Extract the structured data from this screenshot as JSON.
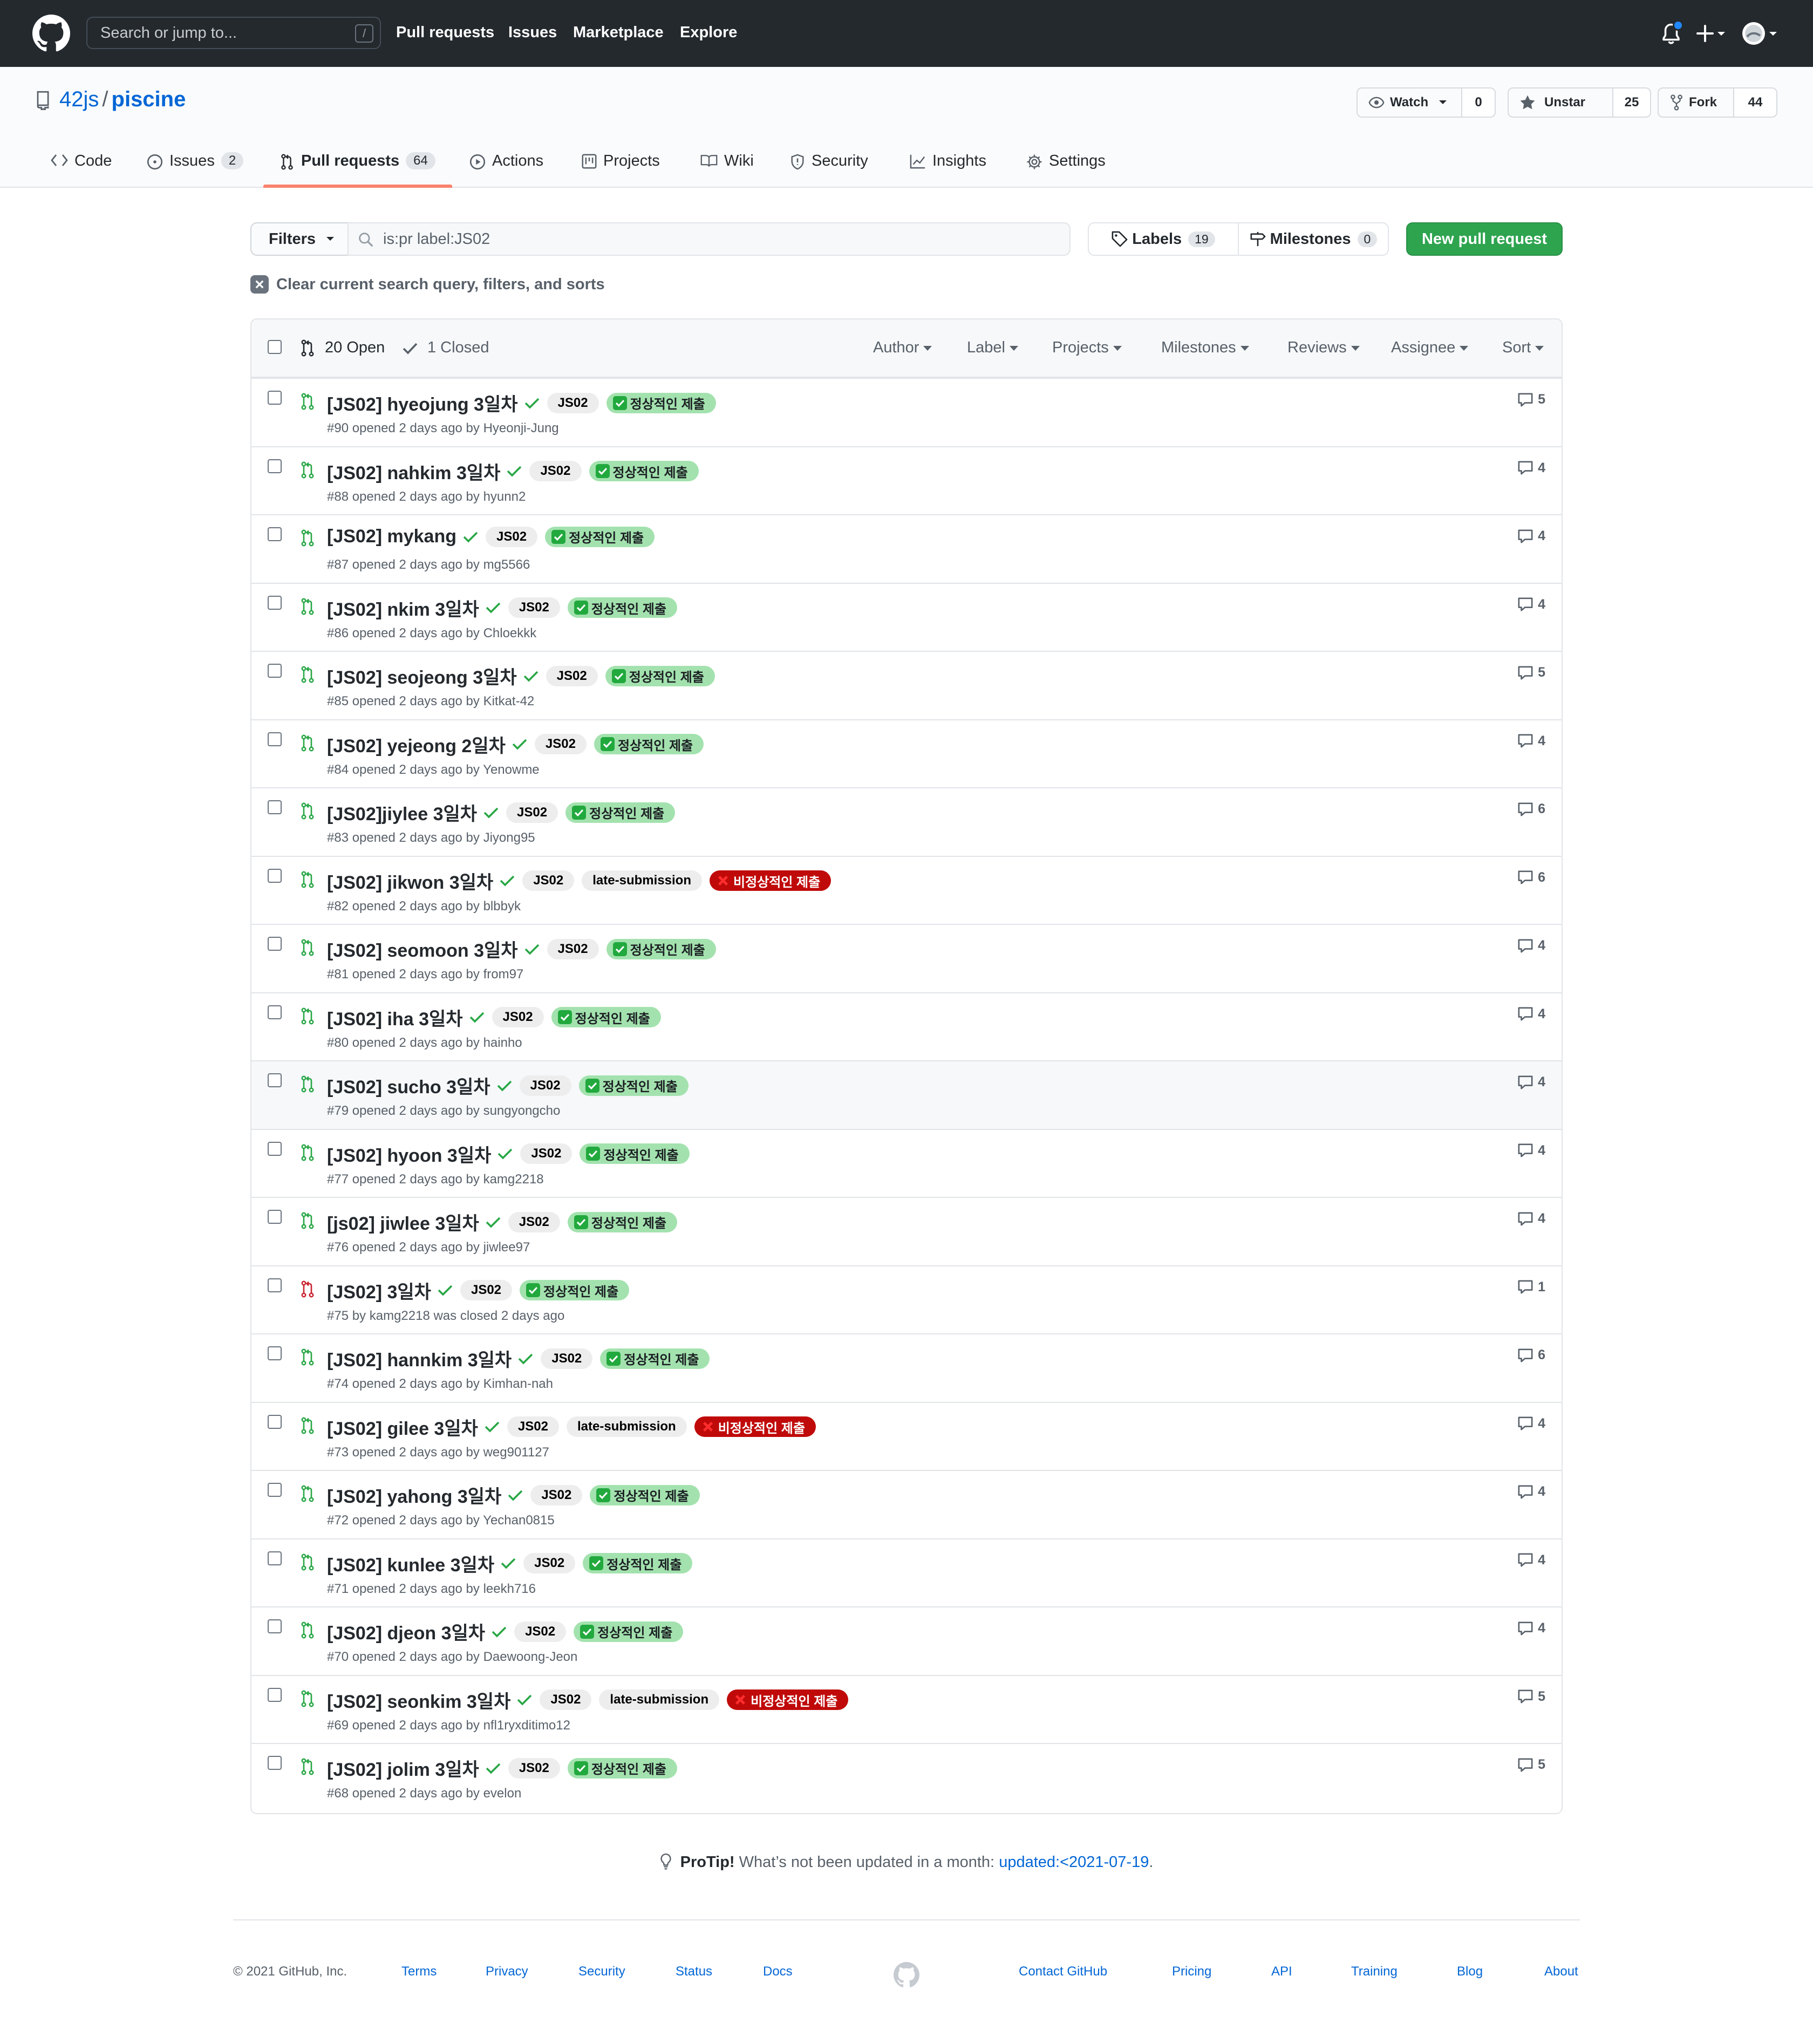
{
  "header": {
    "search_placeholder": "Search or jump to...",
    "search_shortcut": "/",
    "nav": [
      "Pull requests",
      "Issues",
      "Marketplace",
      "Explore"
    ]
  },
  "repo": {
    "owner": "42js",
    "separator": "/",
    "name": "piscine",
    "watch_label": "Watch",
    "watch_count": "0",
    "star_label": "Unstar",
    "star_count": "25",
    "fork_label": "Fork",
    "fork_count": "44"
  },
  "tabs": [
    {
      "label": "Code",
      "counter": ""
    },
    {
      "label": "Issues",
      "counter": "2"
    },
    {
      "label": "Pull requests",
      "counter": "64"
    },
    {
      "label": "Actions",
      "counter": ""
    },
    {
      "label": "Projects",
      "counter": ""
    },
    {
      "label": "Wiki",
      "counter": ""
    },
    {
      "label": "Security",
      "counter": ""
    },
    {
      "label": "Insights",
      "counter": ""
    },
    {
      "label": "Settings",
      "counter": ""
    }
  ],
  "filters": {
    "filters_label": "Filters",
    "query": "is:pr label:JS02",
    "labels_label": "Labels",
    "labels_count": "19",
    "milestones_label": "Milestones",
    "milestones_count": "0",
    "new_pr_label": "New pull request",
    "clear_label": "Clear current search query, filters, and sorts"
  },
  "list_header": {
    "open": "20 Open",
    "closed": "1 Closed",
    "sorters": [
      "Author",
      "Label",
      "Projects",
      "Milestones",
      "Reviews",
      "Assignee",
      "Sort"
    ]
  },
  "label_texts": {
    "js02": "JS02",
    "late": "late-submission",
    "ok": "정상적인 제출",
    "bad": "비정상적인 제출"
  },
  "prs": [
    {
      "title": "[JS02] hyeojung 3일차",
      "meta": "#90 opened 2 days ago by Hyeonji-Jung",
      "comments": "5",
      "late": false,
      "status": "ok",
      "closed": false
    },
    {
      "title": "[JS02] nahkim 3일차",
      "meta": "#88 opened 2 days ago by hyunn2",
      "comments": "4",
      "late": false,
      "status": "ok",
      "closed": false
    },
    {
      "title": "[JS02] mykang",
      "meta": "#87 opened 2 days ago by mg5566",
      "comments": "4",
      "late": false,
      "status": "ok",
      "closed": false
    },
    {
      "title": "[JS02] nkim 3일차",
      "meta": "#86 opened 2 days ago by Chloekkk",
      "comments": "4",
      "late": false,
      "status": "ok",
      "closed": false
    },
    {
      "title": "[JS02] seojeong 3일차",
      "meta": "#85 opened 2 days ago by Kitkat-42",
      "comments": "5",
      "late": false,
      "status": "ok",
      "closed": false
    },
    {
      "title": "[JS02] yejeong 2일차",
      "meta": "#84 opened 2 days ago by Yenowme",
      "comments": "4",
      "late": false,
      "status": "ok",
      "closed": false
    },
    {
      "title": "[JS02]jiylee 3일차",
      "meta": "#83 opened 2 days ago by Jiyong95",
      "comments": "6",
      "late": false,
      "status": "ok",
      "closed": false
    },
    {
      "title": "[JS02] jikwon 3일차",
      "meta": "#82 opened 2 days ago by blbbyk",
      "comments": "6",
      "late": true,
      "status": "bad",
      "closed": false
    },
    {
      "title": "[JS02] seomoon 3일차",
      "meta": "#81 opened 2 days ago by from97",
      "comments": "4",
      "late": false,
      "status": "ok",
      "closed": false
    },
    {
      "title": "[JS02] iha 3일차",
      "meta": "#80 opened 2 days ago by hainho",
      "comments": "4",
      "late": false,
      "status": "ok",
      "closed": false
    },
    {
      "title": "[JS02] sucho 3일차",
      "meta": "#79 opened 2 days ago by sungyongcho",
      "comments": "4",
      "late": false,
      "status": "ok",
      "closed": false
    },
    {
      "title": "[JS02] hyoon 3일차",
      "meta": "#77 opened 2 days ago by kamg2218",
      "comments": "4",
      "late": false,
      "status": "ok",
      "closed": false
    },
    {
      "title": "[js02] jiwlee 3일차",
      "meta": "#76 opened 2 days ago by jiwlee97",
      "comments": "4",
      "late": false,
      "status": "ok",
      "closed": false
    },
    {
      "title": "[JS02] 3일차",
      "meta": "#75 by kamg2218 was closed 2 days ago",
      "comments": "1",
      "late": false,
      "status": "ok",
      "closed": true
    },
    {
      "title": "[JS02] hannkim 3일차",
      "meta": "#74 opened 2 days ago by Kimhan-nah",
      "comments": "6",
      "late": false,
      "status": "ok",
      "closed": false
    },
    {
      "title": "[JS02] gilee 3일차",
      "meta": "#73 opened 2 days ago by weg901127",
      "comments": "4",
      "late": true,
      "status": "bad",
      "closed": false
    },
    {
      "title": "[JS02] yahong 3일차",
      "meta": "#72 opened 2 days ago by Yechan0815",
      "comments": "4",
      "late": false,
      "status": "ok",
      "closed": false
    },
    {
      "title": "[JS02] kunlee 3일차",
      "meta": "#71 opened 2 days ago by leekh716",
      "comments": "4",
      "late": false,
      "status": "ok",
      "closed": false
    },
    {
      "title": "[JS02] djeon 3일차",
      "meta": "#70 opened 2 days ago by Daewoong-Jeon",
      "comments": "4",
      "late": false,
      "status": "ok",
      "closed": false
    },
    {
      "title": "[JS02] seonkim 3일차",
      "meta": "#69 opened 2 days ago by nfl1ryxditimo12",
      "comments": "5",
      "late": true,
      "status": "bad",
      "closed": false
    },
    {
      "title": "[JS02] jolim 3일차",
      "meta": "#68 opened 2 days ago by evelon",
      "comments": "5",
      "late": false,
      "status": "ok",
      "closed": false
    }
  ],
  "protip": {
    "lead": "ProTip!",
    "text": "What’s not been updated in a month:",
    "link": "updated:<2021-07-19",
    "tail": "."
  },
  "footer": {
    "copyright": "© 2021 GitHub, Inc.",
    "left_links": [
      "Terms",
      "Privacy",
      "Security",
      "Status",
      "Docs"
    ],
    "right_links": [
      "Contact GitHub",
      "Pricing",
      "API",
      "Training",
      "Blog",
      "About"
    ]
  },
  "colors": {
    "open_icon": "#28a745",
    "closed_icon": "#cb2431",
    "label_ok_bg": "#a3e2ae",
    "label_bad_bg": "#c00a0a",
    "new_pr_bg": "#2ea44f",
    "link": "#0366d6"
  }
}
